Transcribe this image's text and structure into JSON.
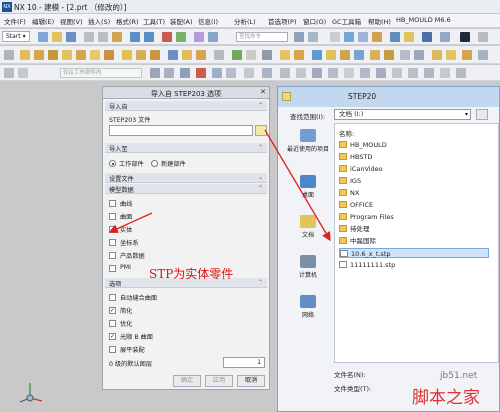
{
  "window": {
    "title": "NX 10 - 建模 - [2.prt （修改的）]",
    "logo": "NX"
  },
  "menu": [
    "文件(F)",
    "编辑(E)",
    "视图(V)",
    "插入(S)",
    "格式(R)",
    "工具(T)",
    "装配(A)",
    "信息(I)",
    "分析(L)",
    "首选项(P)",
    "窗口(O)",
    "GC工具箱",
    "帮助(H)",
    "HB_MOULD M6.6"
  ],
  "toolbar": {
    "start_label": "Start ▾",
    "command_search_placeholder": "查找命令",
    "filter_placeholder": "仅在工作部件内"
  },
  "dialog": {
    "title": "导入自 STEP203 选项",
    "sections": {
      "import_from": "导入自",
      "import_to": "导入至",
      "settings_file": "设置文件",
      "model_data": "模型数据",
      "options": "选项"
    },
    "step_file_label": "STEP203 文件",
    "step_file_value": "",
    "import_to": {
      "work_part": "工作部件",
      "new_part": "新建部件",
      "selected": "work_part"
    },
    "model_data": [
      {
        "label": "曲线",
        "checked": false
      },
      {
        "label": "曲面",
        "checked": false
      },
      {
        "label": "实体",
        "checked": true
      },
      {
        "label": "坐标系",
        "checked": false
      },
      {
        "label": "产品数据",
        "checked": false
      },
      {
        "label": "PMI",
        "checked": false
      }
    ],
    "options": [
      {
        "label": "自动缝合曲面",
        "checked": false
      },
      {
        "label": "简化",
        "checked": true
      },
      {
        "label": "优化",
        "checked": false
      },
      {
        "label": "光顺 B 曲面",
        "checked": true
      },
      {
        "label": "展平装配",
        "checked": false
      }
    ],
    "level_label": "0 级的默认图层",
    "level_value": "1",
    "buttons": {
      "ok": "确定",
      "apply": "应用",
      "cancel": "取消"
    }
  },
  "file_dialog": {
    "title": "STEP20",
    "look_in_label": "查找范围(I):",
    "look_in_value": "文档 (I:)",
    "places": [
      "最近使用的项目",
      "桌面",
      "文档",
      "计算机",
      "网络"
    ],
    "column_name": "名称:",
    "items": [
      {
        "name": "HB_MOULD",
        "type": "folder"
      },
      {
        "name": "HBSTD",
        "type": "folder"
      },
      {
        "name": "iCanVideo",
        "type": "folder"
      },
      {
        "name": "IGS",
        "type": "folder"
      },
      {
        "name": "NX",
        "type": "folder"
      },
      {
        "name": "OFFICE",
        "type": "folder"
      },
      {
        "name": "Program Files",
        "type": "folder"
      },
      {
        "name": "待处理",
        "type": "folder"
      },
      {
        "name": "中磊国际",
        "type": "folder"
      },
      {
        "name": "10.6_x_t.stp",
        "type": "file",
        "selected": true
      },
      {
        "name": "11111111.stp",
        "type": "file"
      }
    ],
    "file_name_label": "文件名(N):",
    "file_type_label": "文件类型(T):"
  },
  "annotation": "STP为实体零件",
  "watermark": {
    "url": "jb51.net",
    "name": "脚本之家"
  },
  "colors": {
    "arrow": "#e02020",
    "accent": "#c33"
  }
}
